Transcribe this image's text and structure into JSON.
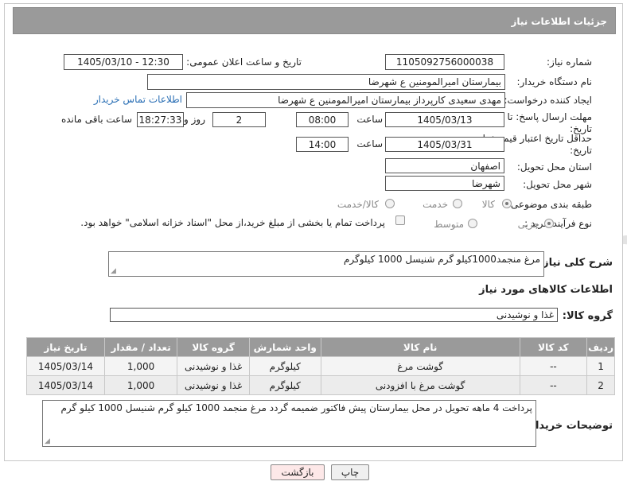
{
  "header": {
    "title": "جزئیات اطلاعات نیاز"
  },
  "fields": {
    "need_number_label": "شماره نیاز:",
    "need_number": "1105092756000038",
    "announce_label": "تاریخ و ساعت اعلان عمومی:",
    "announce_value": "1405/03/10 - 12:30",
    "buyer_org_label": "نام دستگاه خریدار:",
    "buyer_org": "بیمارستان امیرالمومنین ع  شهرضا",
    "requester_label": "ایجاد کننده درخواست:",
    "requester": "مهدی سعیدی کارپرداز بیمارستان امیرالمومنین ع  شهرضا",
    "contact_link": "اطلاعات تماس خریدار",
    "deadline_label": "مهلت ارسال پاسخ: تا تاریخ:",
    "deadline_date": "1405/03/13",
    "time_label": "ساعت",
    "deadline_time": "08:00",
    "days_value": "2",
    "days_label": "روز و",
    "remaining_time": "18:27:33",
    "remaining_label": "ساعت باقی مانده",
    "price_validity_label": "حداقل تاریخ اعتبار قیمت: تا تاریخ:",
    "price_validity_date": "1405/03/31",
    "price_validity_time": "14:00",
    "province_label": "استان محل تحویل:",
    "province": "اصفهان",
    "city_label": "شهر محل تحویل:",
    "city": "شهرضا",
    "category_label": "طبقه بندی موضوعی:",
    "category_options": [
      "کالا",
      "خدمت",
      "کالا/خدمت"
    ],
    "purchase_type_label": "نوع فرآیند خرید :",
    "purchase_options": [
      "جزیی",
      "متوسط"
    ],
    "payment_note": "پرداخت تمام یا بخشی از مبلغ خرید،از محل \"اسناد خزانه اسلامی\" خواهد بود."
  },
  "description": {
    "label": "شرح کلی نیاز:",
    "text": "مرغ منجمد1000کیلو گرم شنیسل 1000 کیلوگرم"
  },
  "goods": {
    "section_title": "اطلاعات کالاهای مورد نیاز",
    "group_label": "گروه کالا:",
    "group_value": "غذا و نوشیدنی",
    "columns": [
      "ردیف",
      "کد کالا",
      "نام کالا",
      "واحد شمارش",
      "گروه کالا",
      "تعداد / مقدار",
      "تاریخ نیاز"
    ],
    "rows": [
      [
        "1",
        "--",
        "گوشت مرغ",
        "کیلوگرم",
        "غذا و نوشیدنی",
        "1,000",
        "1405/03/14"
      ],
      [
        "2",
        "--",
        "گوشت مرغ با افزودنی",
        "کیلوگرم",
        "غذا و نوشیدنی",
        "1,000",
        "1405/03/14"
      ]
    ]
  },
  "buyer_notes": {
    "label": "توضیحات خریدار:",
    "text": "پرداخت 4 ماهه تحویل در محل بیمارستان پیش فاکتور ضمیمه گردد مرغ منجمد 1000 کیلو گرم شنیسل 1000 کیلو گرم"
  },
  "buttons": {
    "print": "چاپ",
    "back": "بازگشت"
  },
  "colors": {
    "header_bg": "#9a9a9a",
    "link": "#2a6fb5",
    "back_button_bg": "#fde8e8"
  }
}
